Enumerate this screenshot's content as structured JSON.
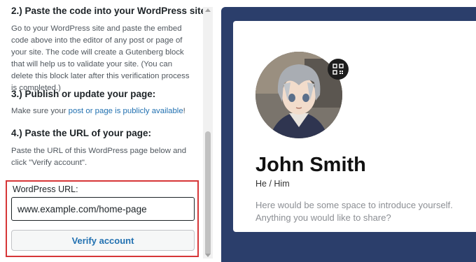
{
  "steps": {
    "step2": {
      "heading": "2.) Paste the code into your WordPress site:",
      "text": "Go to your WordPress site and paste the embed code above into the editor of any post or page of your site. The code will create a Gutenberg block that will help us to validate your site. (You can delete this block later after this verification process is completed.)"
    },
    "step3": {
      "heading": "3.) Publish or update your page:",
      "text_before": "Make sure your ",
      "link": "post or page is publicly available",
      "text_after": "!"
    },
    "step4": {
      "heading": "4.) Paste the URL of your page:",
      "text": "Paste the URL of this WordPress page below and click \"Verify account\"."
    }
  },
  "url_form": {
    "label": "WordPress URL:",
    "value": "www.example.com/home-page",
    "button_label": "Verify account"
  },
  "profile": {
    "name": "John Smith",
    "pronouns": "He / Him",
    "bio": "Here would be some space to introduce yourself. Anything you would like to share?"
  },
  "colors": {
    "preview_background": "#2b3e6b",
    "link": "#2271b1",
    "highlight_border": "#d63638"
  },
  "icons": {
    "qr": "qr-code-icon"
  }
}
